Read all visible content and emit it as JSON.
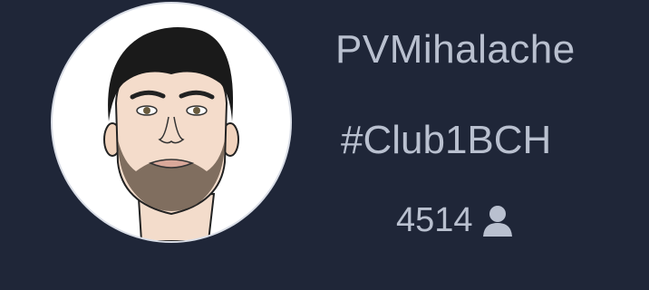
{
  "profile": {
    "username": "PVMihalache",
    "hashtag": "#Club1BCH",
    "followers_count": "4514",
    "followers_icon": "user-icon",
    "avatar_icon": "avatar-portrait"
  },
  "colors": {
    "background": "#1f2638",
    "text": "#b9c0cf",
    "avatar_bg": "#ffffff"
  }
}
